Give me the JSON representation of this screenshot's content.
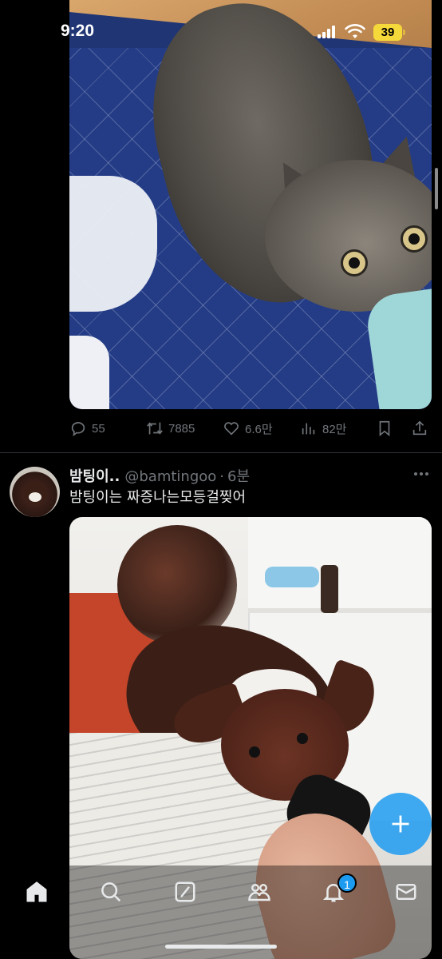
{
  "status_bar": {
    "time": "9:20",
    "battery": "39"
  },
  "tweet1": {
    "stats": {
      "replies": "55",
      "retweets": "7885",
      "likes": "6.6만",
      "views": "82만"
    }
  },
  "tweet2": {
    "display_name": "밤팅이..",
    "handle": "@bamtingoo",
    "separator": "·",
    "time": "6분",
    "text": "밤팅이는 짜증나는모등걸찢어"
  },
  "bottom_nav": {
    "items": [
      "home-icon",
      "search-icon",
      "grok-icon",
      "communities-icon",
      "notifications-icon",
      "messages-icon"
    ],
    "notification_badge": "1"
  },
  "colors": {
    "accent": "#1d9bf0",
    "muted": "#71767b",
    "text": "#e7e9ea",
    "background": "#000000",
    "battery": "#f5d93a"
  }
}
